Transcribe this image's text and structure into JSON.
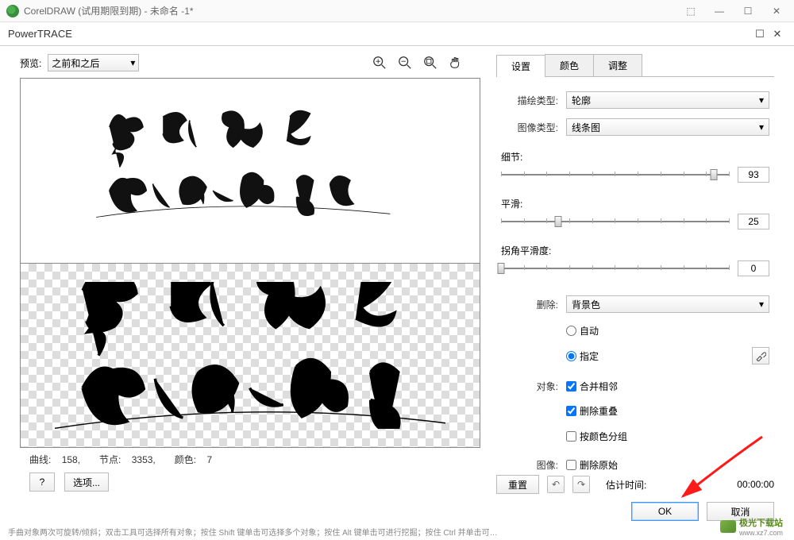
{
  "titlebar": {
    "app_title": "CorelDRAW (试用期限到期) - 未命名 -1*"
  },
  "dialog": {
    "title": "PowerTRACE"
  },
  "preview": {
    "label": "预览:",
    "mode": "之前和之后"
  },
  "stats": {
    "curves_label": "曲线:",
    "curves": "158,",
    "nodes_label": "节点:",
    "nodes": "3353,",
    "colors_label": "颜色:",
    "colors": "7"
  },
  "buttons": {
    "help": "?",
    "options": "选项...",
    "reset": "重置",
    "ok": "OK",
    "cancel": "取消"
  },
  "tabs": {
    "settings": "设置",
    "colors": "颜色",
    "adjust": "调整"
  },
  "settings": {
    "trace_type_label": "描绘类型:",
    "trace_type": "轮廓",
    "image_type_label": "图像类型:",
    "image_type": "线条图",
    "detail_label": "细节:",
    "detail_value": "93",
    "smooth_label": "平滑:",
    "smooth_value": "25",
    "corner_label": "拐角平滑度:",
    "corner_value": "0",
    "delete_label": "删除:",
    "delete_option": "背景色",
    "radio_auto": "自动",
    "radio_specify": "指定",
    "object_label": "对象:",
    "merge_adj": "合并相邻",
    "remove_overlap": "删除重叠",
    "group_by_color": "按颜色分组",
    "image_label": "图像:",
    "remove_original": "删除原始"
  },
  "footer": {
    "est_time_label": "估计时间:",
    "est_time_value": "00:00:00"
  },
  "status_hint": "手曲对象两次可旋转/倾斜；双击工具可选择所有对象；按住 Shift 键单击可选择多个对象；按住 Alt 键单击可进行挖掘；按住 Ctrl 并单击可…",
  "watermark": {
    "site": "极光下载站",
    "url": "www.xz7.com"
  }
}
